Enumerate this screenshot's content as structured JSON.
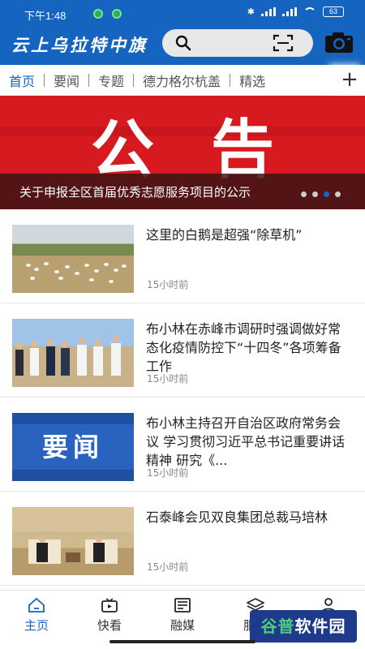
{
  "status": {
    "time": "下午1:48",
    "battery": "63"
  },
  "header": {
    "brand": "云上乌拉特中旗"
  },
  "tabs": [
    {
      "label": "首页",
      "active": true
    },
    {
      "label": "要闻"
    },
    {
      "label": "专题"
    },
    {
      "label": "德力格尔杭盖"
    },
    {
      "label": "精选"
    }
  ],
  "tabs_add": "+",
  "banner": {
    "big_text": "公告",
    "caption": "关于申报全区首届优秀志愿服务项目的公示"
  },
  "news": [
    {
      "title": "这里的白鹅是超强“除草机”",
      "time": "15小时前",
      "thumb": "geese"
    },
    {
      "title": "布小林在赤峰市调研时强调做好常态化疫情防控下“十四冬”各项筹备工作",
      "time": "15小时前",
      "thumb": "people"
    },
    {
      "title": "布小林主持召开自治区政府常务会议 学习贯彻习近平总书记重要讲话精神 研究《...",
      "time": "15小时前",
      "thumb": "yaowen",
      "thumb_text": "要闻"
    },
    {
      "title": "石泰峰会见双良集团总裁马培林",
      "time": "15小时前",
      "thumb": "meeting"
    }
  ],
  "bottom_nav": [
    {
      "label": "主页",
      "icon": "home-icon",
      "active": true
    },
    {
      "label": "快看",
      "icon": "video-icon"
    },
    {
      "label": "融媒",
      "icon": "newspaper-icon"
    },
    {
      "label": "服务",
      "icon": "layers-icon"
    },
    {
      "label": "我的",
      "icon": "user-icon"
    }
  ],
  "watermark": {
    "left": "谷普",
    "right": "软件园"
  },
  "colors": {
    "brand_blue": "#1565c0",
    "banner_red": "#d71920"
  }
}
